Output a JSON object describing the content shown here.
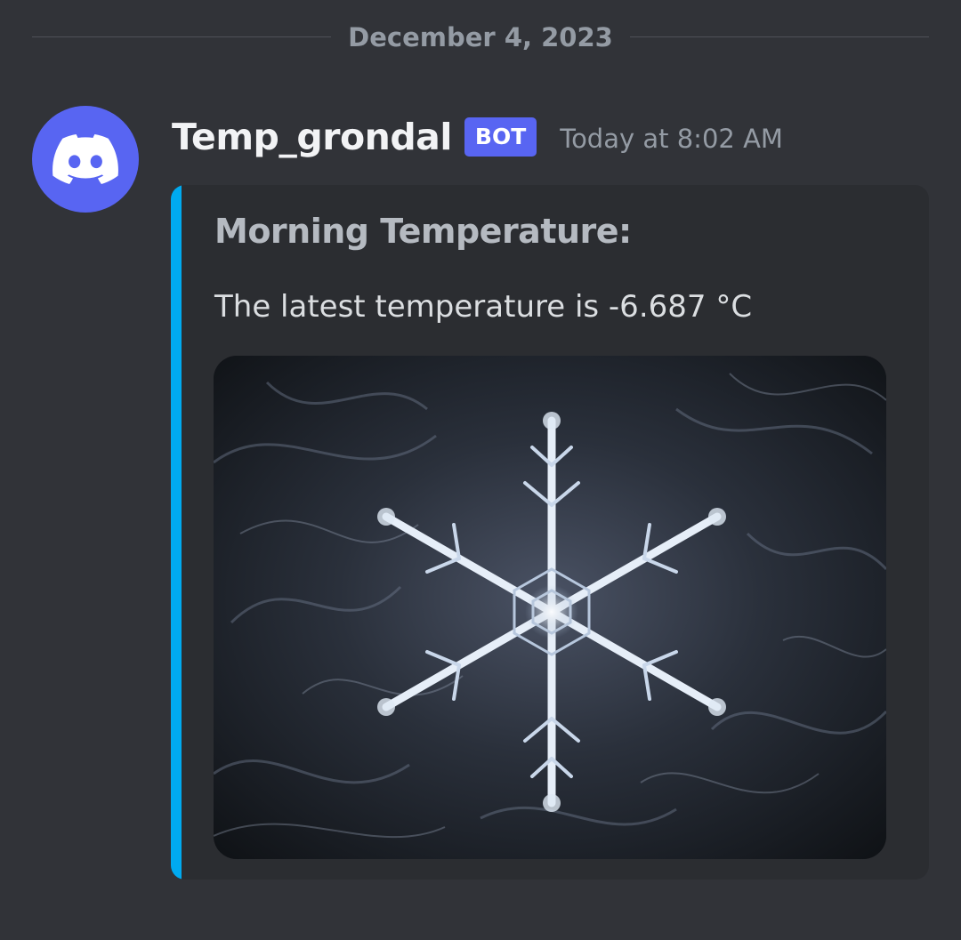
{
  "date_divider": "December 4, 2023",
  "message": {
    "author": "Temp_grondal",
    "badge": "BOT",
    "timestamp": "Today at 8:02 AM",
    "avatar_icon": "discord-logo-icon",
    "embed": {
      "accent_color": "#00aaf0",
      "title": "Morning Temperature:",
      "description": "The latest temperature is -6.687 °C",
      "image_subject": "snowflake-macro-photo"
    }
  },
  "colors": {
    "background": "#313338",
    "embed_background": "#2b2d31",
    "badge": "#5865f2",
    "avatar": "#5865f2"
  }
}
